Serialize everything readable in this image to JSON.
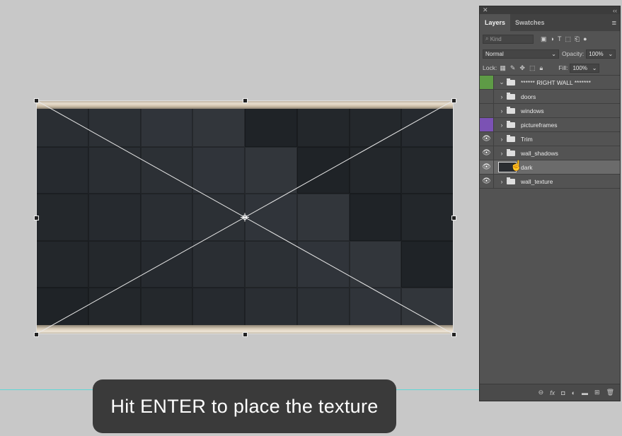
{
  "caption": "Hit ENTER to place the texture",
  "panel": {
    "tabs": [
      {
        "label": "Layers",
        "active": true
      },
      {
        "label": "Swatches",
        "active": false
      }
    ],
    "filter_kind": "Kind",
    "blend_mode": "Normal",
    "opacity_label": "Opacity:",
    "opacity_value": "100%",
    "lock_label": "Lock:",
    "fill_label": "Fill:",
    "fill_value": "100%",
    "layers": [
      {
        "name": "****** RIGHT WALL *******",
        "type": "group",
        "visible": false,
        "color": "#5e9b46",
        "expanded": true
      },
      {
        "name": "doors",
        "type": "group",
        "visible": false,
        "color": null
      },
      {
        "name": "windows",
        "type": "group",
        "visible": false,
        "color": null
      },
      {
        "name": "pictureframes",
        "type": "group",
        "visible": false,
        "color": "#7b52b4"
      },
      {
        "name": "Trim",
        "type": "group",
        "visible": true,
        "color": null
      },
      {
        "name": "wall_shadows",
        "type": "group",
        "visible": true,
        "color": null
      },
      {
        "name": "dark",
        "type": "smart-object",
        "visible": true,
        "color": null,
        "selected": true
      },
      {
        "name": "wall_texture",
        "type": "group",
        "visible": true,
        "color": null
      }
    ]
  },
  "colors": {
    "workspace": "#c8c8c8",
    "guide": "#5fd6d6",
    "panel": "#535353",
    "group_green": "#5e9b46",
    "group_purple": "#7b52b4"
  }
}
